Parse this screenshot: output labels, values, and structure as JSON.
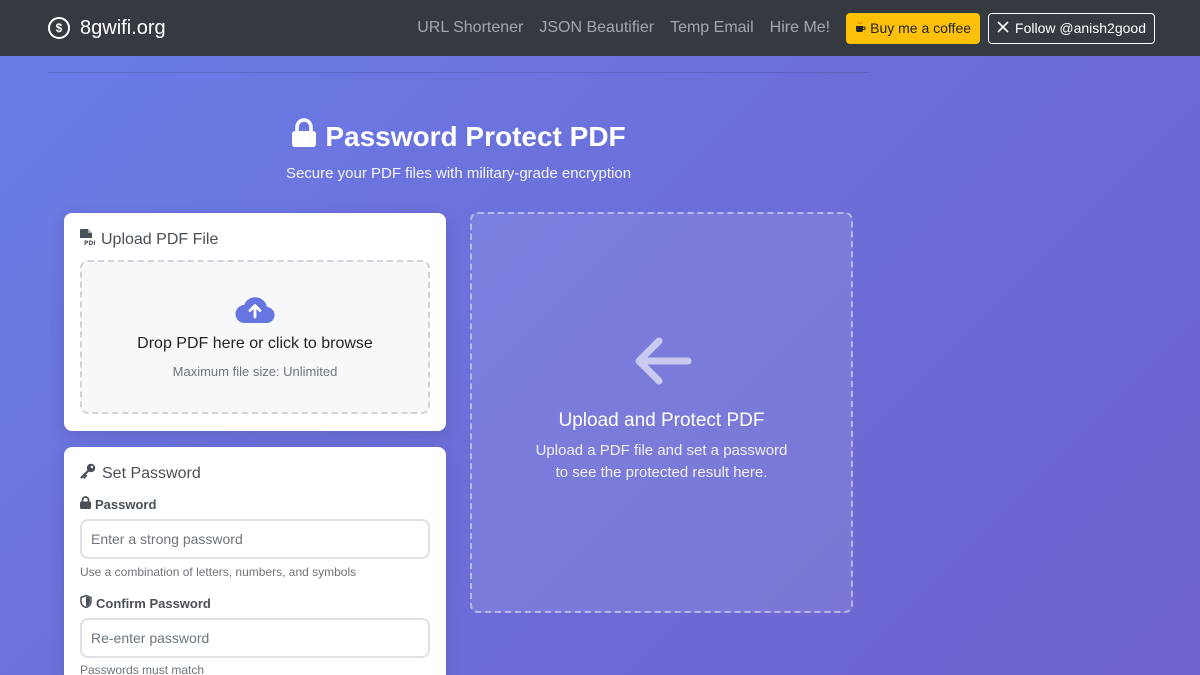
{
  "navbar": {
    "brand": "8gwifi.org",
    "links": [
      "URL Shortener",
      "JSON Beautifier",
      "Temp Email",
      "Hire Me!"
    ],
    "coffee_label": "Buy me a coffee",
    "follow_label": "Follow @anish2good"
  },
  "hero": {
    "title": "Password Protect PDF",
    "subtitle": "Secure your PDF files with military-grade encryption"
  },
  "upload_card": {
    "header": "Upload PDF File",
    "drop_title": "Drop PDF here or click to browse",
    "drop_sub": "Maximum file size: Unlimited"
  },
  "password_card": {
    "header": "Set Password",
    "password_label": "Password",
    "password_placeholder": "Enter a strong password",
    "password_help": "Use a combination of letters, numbers, and symbols",
    "confirm_label": "Confirm Password",
    "confirm_placeholder": "Re-enter password",
    "confirm_help": "Passwords must match"
  },
  "result_panel": {
    "title": "Upload and Protect PDF",
    "line1": "Upload a PDF file and set a password",
    "line2": "to see the protected result here."
  },
  "colors": {
    "navbar_bg": "#343a40",
    "coffee_button": "#ffc107",
    "accent": "#667eea"
  }
}
